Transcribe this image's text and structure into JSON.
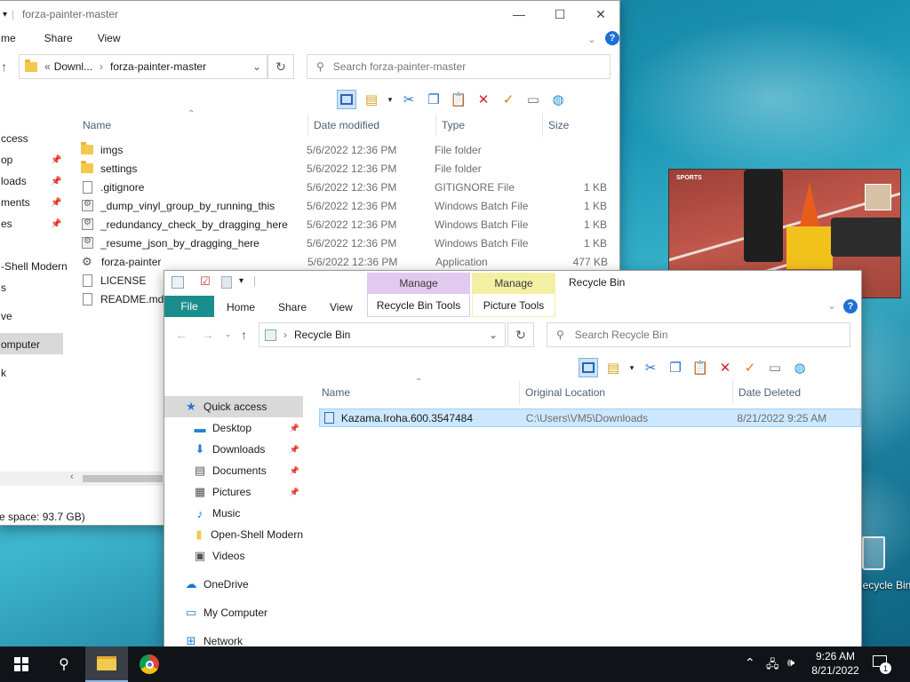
{
  "desktop": {
    "recycle_label": "Recycle Bin"
  },
  "win1": {
    "title": "forza-painter-master",
    "menu": [
      "me",
      "Share",
      "View"
    ],
    "address": {
      "prefix": "Downl...",
      "current": "forza-painter-master"
    },
    "search_placeholder": "Search forza-painter-master",
    "columns": [
      "Name",
      "Date modified",
      "Type",
      "Size"
    ],
    "nav": [
      "ccess",
      "op",
      "loads",
      "ments",
      "es",
      "-Shell Modern",
      "s",
      "ve",
      "omputer",
      "k"
    ],
    "files": [
      {
        "icon": "folder",
        "name": "imgs",
        "date": "5/6/2022 12:36 PM",
        "type": "File folder",
        "size": ""
      },
      {
        "icon": "folder",
        "name": "settings",
        "date": "5/6/2022 12:36 PM",
        "type": "File folder",
        "size": ""
      },
      {
        "icon": "file",
        "name": ".gitignore",
        "date": "5/6/2022 12:36 PM",
        "type": "GITIGNORE File",
        "size": "1 KB"
      },
      {
        "icon": "bat",
        "name": "_dump_vinyl_group_by_running_this",
        "date": "5/6/2022 12:36 PM",
        "type": "Windows Batch File",
        "size": "1 KB"
      },
      {
        "icon": "bat",
        "name": "_redundancy_check_by_dragging_here",
        "date": "5/6/2022 12:36 PM",
        "type": "Windows Batch File",
        "size": "1 KB"
      },
      {
        "icon": "bat",
        "name": "_resume_json_by_dragging_here",
        "date": "5/6/2022 12:36 PM",
        "type": "Windows Batch File",
        "size": "1 KB"
      },
      {
        "icon": "app",
        "name": "forza-painter",
        "date": "5/6/2022 12:36 PM",
        "type": "Application",
        "size": "477 KB"
      },
      {
        "icon": "file",
        "name": "LICENSE",
        "date": "",
        "type": "",
        "size": ""
      },
      {
        "icon": "file",
        "name": "README.md",
        "date": "",
        "type": "",
        "size": ""
      }
    ],
    "status": "e space: 93.7 GB)"
  },
  "win2": {
    "title": "Recycle Bin",
    "manage1": "Manage",
    "manage2": "Manage",
    "tools1": "Recycle Bin Tools",
    "tools2": "Picture Tools",
    "tabs": [
      "File",
      "Home",
      "Share",
      "View"
    ],
    "address": "Recycle Bin",
    "search_placeholder": "Search Recycle Bin",
    "columns": [
      "Name",
      "Original Location",
      "Date Deleted"
    ],
    "nav": [
      {
        "label": "Quick access",
        "icon": "star",
        "pin": false
      },
      {
        "label": "Desktop",
        "icon": "desktop",
        "pin": true
      },
      {
        "label": "Downloads",
        "icon": "download",
        "pin": true
      },
      {
        "label": "Documents",
        "icon": "doc",
        "pin": true
      },
      {
        "label": "Pictures",
        "icon": "pic",
        "pin": true
      },
      {
        "label": "Music",
        "icon": "music",
        "pin": false
      },
      {
        "label": "Open-Shell Modern",
        "icon": "folder",
        "pin": false
      },
      {
        "label": "Videos",
        "icon": "video",
        "pin": false
      },
      {
        "label": "OneDrive",
        "icon": "cloud",
        "pin": false
      },
      {
        "label": "My Computer",
        "icon": "pc",
        "pin": false
      },
      {
        "label": "Network",
        "icon": "network",
        "pin": false
      }
    ],
    "item": {
      "name": "Kazama.Iroha.600.3547484",
      "location": "C:\\Users\\VM5\\Downloads",
      "deleted": "8/21/2022 9:25 AM"
    }
  },
  "video_overlay": {
    "sports_tag": "SPORTS"
  },
  "taskbar": {
    "time": "9:26 AM",
    "date": "8/21/2022",
    "notif_count": "1"
  }
}
